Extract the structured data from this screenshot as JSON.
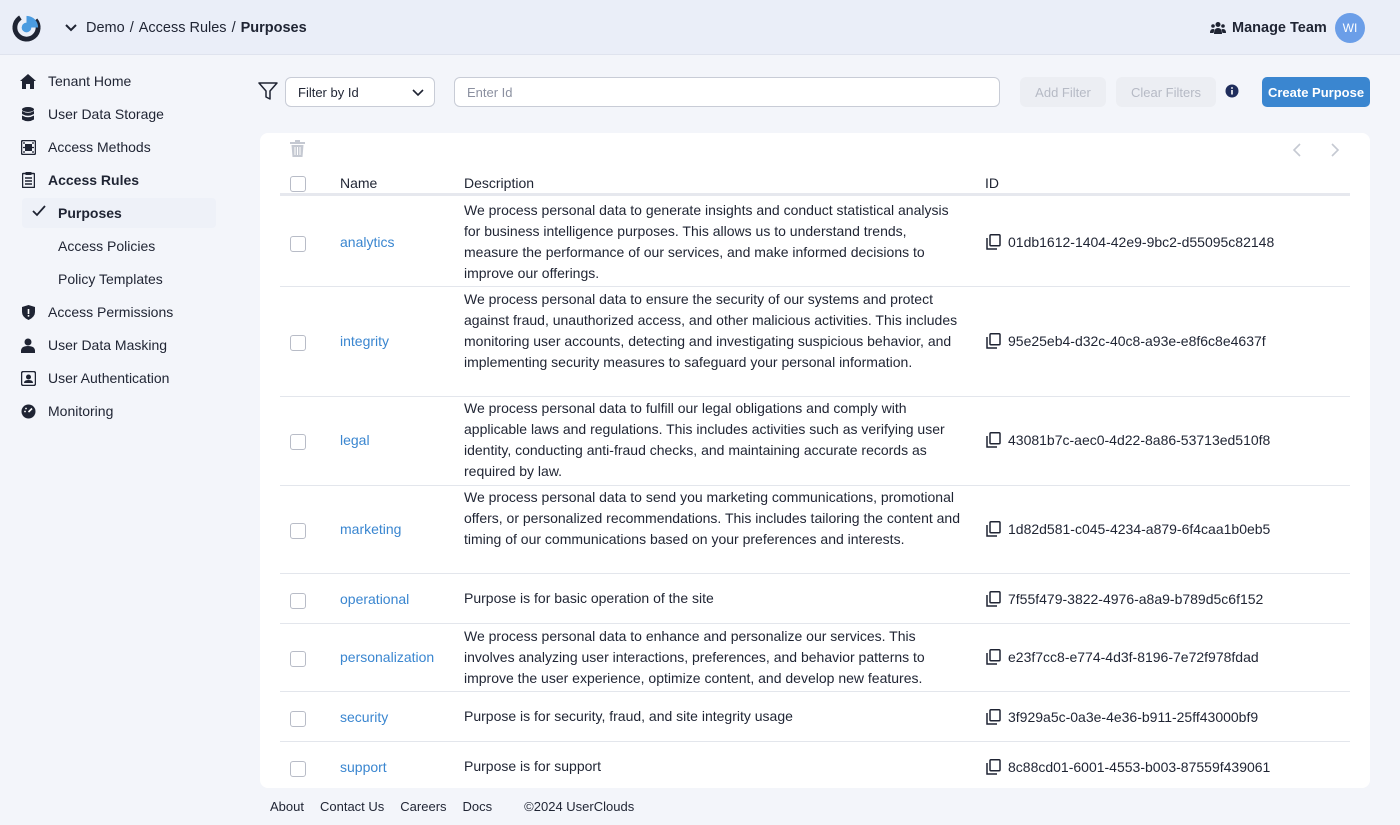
{
  "header": {
    "breadcrumb": [
      "Demo",
      "Access Rules",
      "Purposes"
    ],
    "manage_team": "Manage Team",
    "avatar_initials": "WI"
  },
  "sidebar": {
    "items": [
      {
        "label": "Tenant Home",
        "icon": "home-icon"
      },
      {
        "label": "User Data Storage",
        "icon": "database-icon"
      },
      {
        "label": "Access Methods",
        "icon": "chip-icon"
      },
      {
        "label": "Access Rules",
        "icon": "clipboard-icon"
      },
      {
        "label": "Access Permissions",
        "icon": "shield-icon"
      },
      {
        "label": "User Data Masking",
        "icon": "user-mask-icon"
      },
      {
        "label": "User Authentication",
        "icon": "auth-icon"
      },
      {
        "label": "Monitoring",
        "icon": "gauge-icon"
      }
    ],
    "sub_items": [
      {
        "label": "Purposes"
      },
      {
        "label": "Access Policies"
      },
      {
        "label": "Policy Templates"
      }
    ]
  },
  "filter": {
    "select_value": "Filter by Id",
    "input_placeholder": "Enter Id",
    "add_filter": "Add Filter",
    "clear_filters": "Clear Filters",
    "create_purpose": "Create Purpose"
  },
  "table": {
    "columns": [
      "Name",
      "Description",
      "ID"
    ],
    "rows": [
      {
        "name": "analytics",
        "description": "We process personal data to generate insights and conduct statistical analysis for business intelligence purposes. This allows us to understand trends, measure the performance of our services, and make informed decisions to improve our offerings.",
        "id": "01db1612-1404-42e9-9bc2-d55095c82148"
      },
      {
        "name": "integrity",
        "description": "We process personal data to ensure the security of our systems and protect against fraud, unauthorized access, and other malicious activities. This includes monitoring user accounts, detecting and investigating suspicious behavior, and implementing security measures to safeguard your personal information.",
        "id": "95e25eb4-d32c-40c8-a93e-e8f6c8e4637f"
      },
      {
        "name": "legal",
        "description": "We process personal data to fulfill our legal obligations and comply with applicable laws and regulations. This includes activities such as verifying user identity, conducting anti-fraud checks, and maintaining accurate records as required by law.",
        "id": "43081b7c-aec0-4d22-8a86-53713ed510f8"
      },
      {
        "name": "marketing",
        "description": "We process personal data to send you marketing communications, promotional offers, or personalized recommendations. This includes tailoring the content and timing of our communications based on your preferences and interests.",
        "id": "1d82d581-c045-4234-a879-6f4caa1b0eb5"
      },
      {
        "name": "operational",
        "description": "Purpose is for basic operation of the site",
        "id": "7f55f479-3822-4976-a8a9-b789d5c6f152"
      },
      {
        "name": "personalization",
        "description": "We process personal data to enhance and personalize our services. This involves analyzing user interactions, preferences, and behavior patterns to improve the user experience, optimize content, and develop new features.",
        "id": "e23f7cc8-e774-4d3f-8196-7e72f978fdad"
      },
      {
        "name": "security",
        "description": "Purpose is for security, fraud, and site integrity usage",
        "id": "3f929a5c-0a3e-4e36-b911-25ff43000bf9"
      },
      {
        "name": "support",
        "description": "Purpose is for support",
        "id": "8c88cd01-6001-4553-b003-87559f439061"
      }
    ]
  },
  "footer": {
    "links": [
      "About",
      "Contact Us",
      "Careers",
      "Docs"
    ],
    "copyright": "©2024 UserClouds"
  },
  "colors": {
    "accent": "#3a86d0",
    "header_bg": "#eaeef8",
    "page_bg": "#f3f5fa"
  }
}
